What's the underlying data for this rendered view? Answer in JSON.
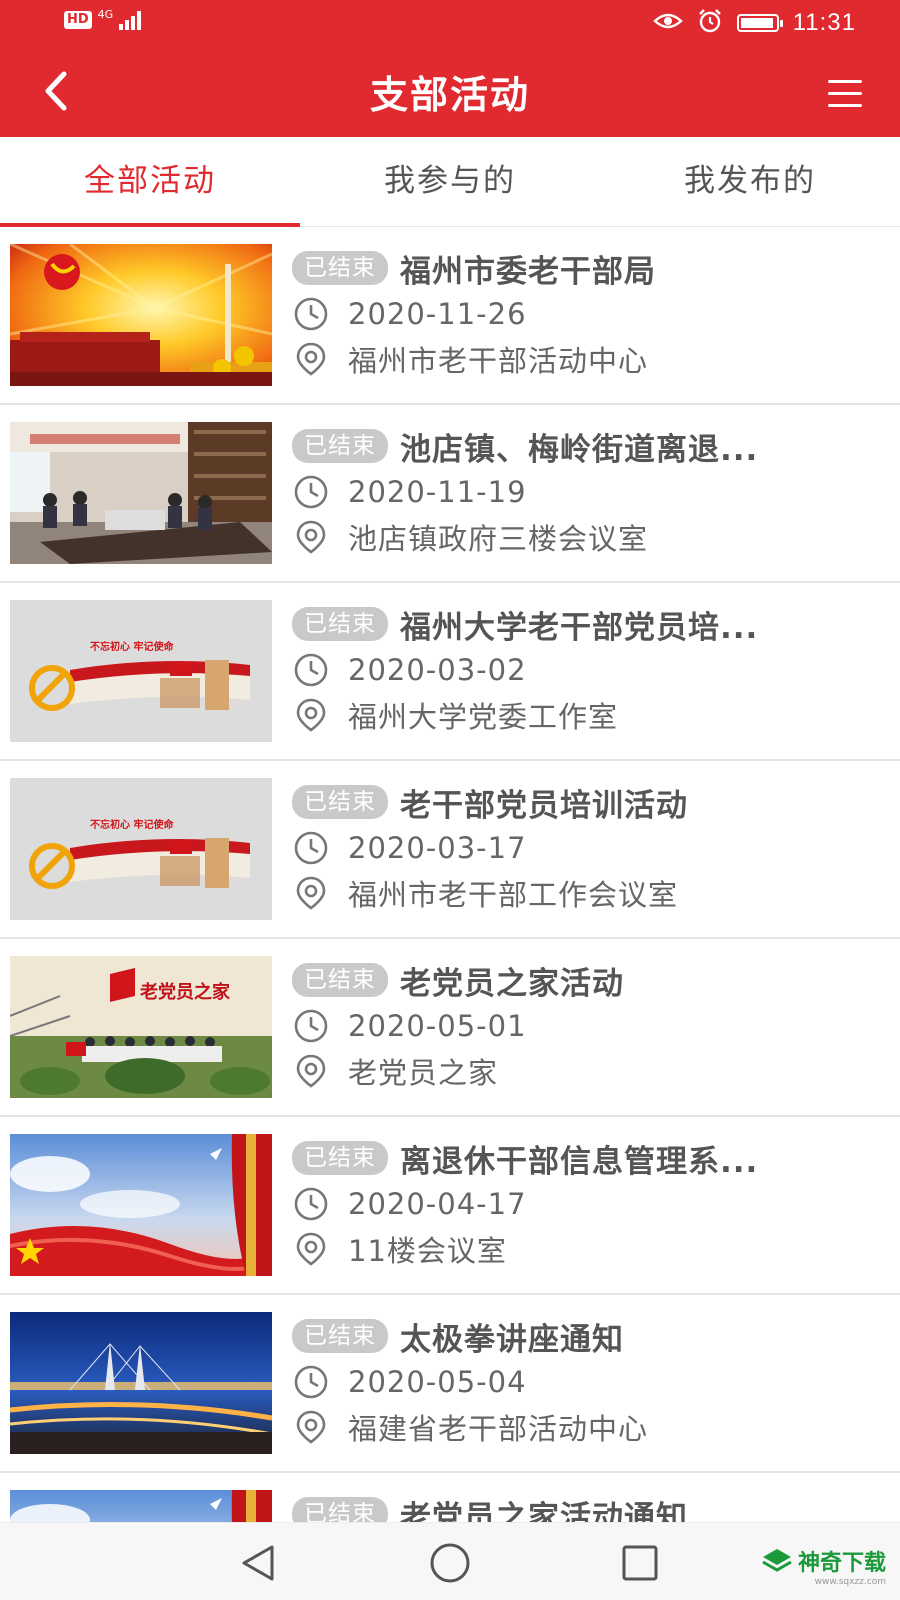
{
  "status_bar": {
    "hd": "HD",
    "network": "4G",
    "time": "11:31"
  },
  "nav": {
    "title": "支部活动"
  },
  "tabs": [
    {
      "label": "全部活动",
      "active": true
    },
    {
      "label": "我参与的",
      "active": false
    },
    {
      "label": "我发布的",
      "active": false
    }
  ],
  "activities": [
    {
      "status": "已结束",
      "title": "福州市委老干部局",
      "date": "2020-11-26",
      "location": "福州市老干部活动中心",
      "image": "sunburst-party"
    },
    {
      "status": "已结束",
      "title": "池店镇、梅岭街道离退...",
      "date": "2020-11-19",
      "location": "池店镇政府三楼会议室",
      "image": "meeting-room"
    },
    {
      "status": "已结束",
      "title": "福州大学老干部党员培...",
      "date": "2020-03-02",
      "location": "福州大学党委工作室",
      "image": "party-wall",
      "image_text": "不忘初心  牢记使命"
    },
    {
      "status": "已结束",
      "title": "老干部党员培训活动",
      "date": "2020-03-17",
      "location": "福州市老干部工作会议室",
      "image": "party-wall",
      "image_text": "不忘初心  牢记使命"
    },
    {
      "status": "已结束",
      "title": "老党员之家活动",
      "date": "2020-05-01",
      "location": "老党员之家",
      "image": "group-photo",
      "image_text": "老党员之家"
    },
    {
      "status": "已结束",
      "title": "离退休干部信息管理系...",
      "date": "2020-04-17",
      "location": "11楼会议室",
      "image": "sky-flag"
    },
    {
      "status": "已结束",
      "title": "太极拳讲座通知",
      "date": "2020-05-04",
      "location": "福建省老干部活动中心",
      "image": "city-bridge"
    },
    {
      "status": "已结束",
      "title": "老党员之家活动通知",
      "date": "",
      "location": "",
      "image": "sky-flag"
    }
  ],
  "watermark": {
    "text": "神奇下载",
    "url": "www.sqxzz.com"
  },
  "colors": {
    "brand_red": "#e02a2f",
    "badge_gray": "#c9c9c9",
    "watermark_green": "#1a9a3a"
  },
  "icons": {
    "back": "chevron-left-icon",
    "menu": "hamburger-menu-icon",
    "clock": "clock-icon",
    "location": "location-pin-icon"
  }
}
